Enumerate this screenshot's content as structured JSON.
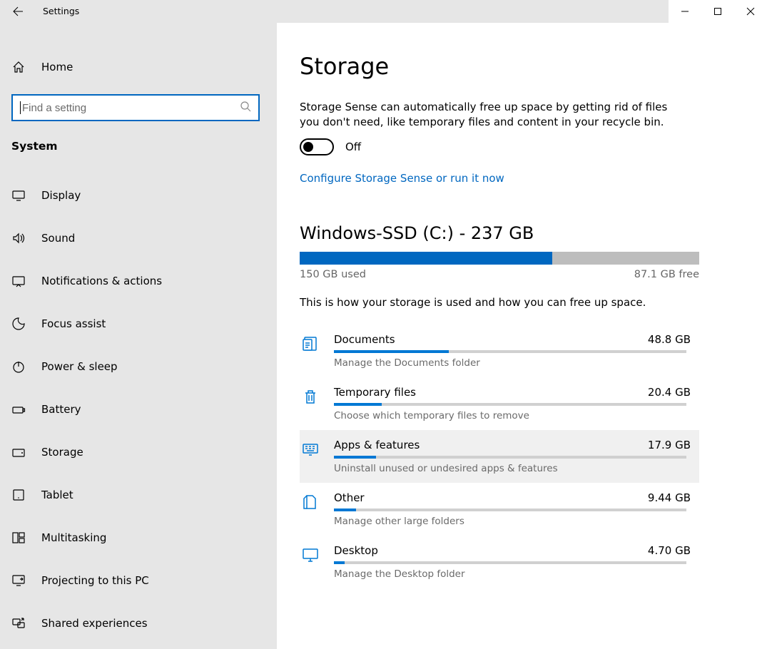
{
  "window": {
    "title": "Settings"
  },
  "sidebar": {
    "home_label": "Home",
    "search_placeholder": "Find a setting",
    "section_label": "System",
    "items": [
      {
        "id": "display",
        "label": "Display"
      },
      {
        "id": "sound",
        "label": "Sound"
      },
      {
        "id": "notifications",
        "label": "Notifications & actions"
      },
      {
        "id": "focus-assist",
        "label": "Focus assist"
      },
      {
        "id": "power-sleep",
        "label": "Power & sleep"
      },
      {
        "id": "battery",
        "label": "Battery"
      },
      {
        "id": "storage",
        "label": "Storage"
      },
      {
        "id": "tablet",
        "label": "Tablet"
      },
      {
        "id": "multitasking",
        "label": "Multitasking"
      },
      {
        "id": "projecting",
        "label": "Projecting to this PC"
      },
      {
        "id": "shared-exp",
        "label": "Shared experiences"
      }
    ]
  },
  "page": {
    "title": "Storage",
    "sense_description": "Storage Sense can automatically free up space by getting rid of files you don't need, like temporary files and content in your recycle bin.",
    "toggle_state": "Off",
    "configure_link": "Configure Storage Sense or run it now",
    "drive": {
      "title": "Windows-SSD (C:) - 237 GB",
      "total_gb": 237,
      "used_label": "150 GB used",
      "used_gb": 150,
      "free_label": "87.1 GB free",
      "free_gb": 87.1,
      "usage_desc": "This is how your storage is used and how you can free up space."
    },
    "categories": [
      {
        "id": "documents",
        "label": "Documents",
        "size_label": "48.8 GB",
        "size_gb": 48.8,
        "hint": "Manage the Documents folder"
      },
      {
        "id": "temp",
        "label": "Temporary files",
        "size_label": "20.4 GB",
        "size_gb": 20.4,
        "hint": "Choose which temporary files to remove"
      },
      {
        "id": "apps",
        "label": "Apps & features",
        "size_label": "17.9 GB",
        "size_gb": 17.9,
        "hint": "Uninstall unused or undesired apps & features",
        "hover": true
      },
      {
        "id": "other",
        "label": "Other",
        "size_label": "9.44 GB",
        "size_gb": 9.44,
        "hint": "Manage other large folders"
      },
      {
        "id": "desktop",
        "label": "Desktop",
        "size_label": "4.70 GB",
        "size_gb": 4.7,
        "hint": "Manage the Desktop folder"
      }
    ]
  },
  "chart_data": {
    "type": "bar",
    "title": "Windows-SSD (C:) storage usage",
    "xlabel": "",
    "ylabel": "GB",
    "ylim": [
      0,
      237
    ],
    "categories": [
      "Used",
      "Free"
    ],
    "values": [
      150,
      87.1
    ],
    "breakdown": {
      "categories": [
        "Documents",
        "Temporary files",
        "Apps & features",
        "Other",
        "Desktop"
      ],
      "values": [
        48.8,
        20.4,
        17.9,
        9.44,
        4.7
      ]
    }
  }
}
